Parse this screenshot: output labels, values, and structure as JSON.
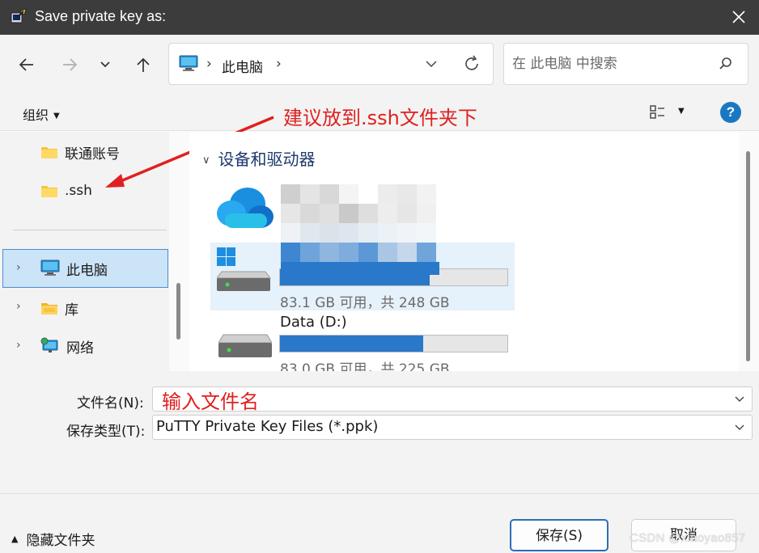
{
  "window": {
    "title": "Save private key as:"
  },
  "nav": {
    "breadcrumb": "此电脑",
    "search_placeholder": "在 此电脑 中搜索"
  },
  "toolbar": {
    "organize_label": "组织"
  },
  "annotations": {
    "folder_hint": "建议放到.ssh文件夹下",
    "filename_hint": "输入文件名"
  },
  "left_pane": {
    "items": [
      {
        "label": "联通账号"
      },
      {
        "label": ".ssh"
      },
      {
        "label": "此电脑"
      },
      {
        "label": "库"
      },
      {
        "label": "网络"
      }
    ]
  },
  "right_pane": {
    "group_label": "设备和驱动器",
    "drives": [
      {
        "name": "",
        "info": "",
        "icon": "onedrive-cloud-icon"
      },
      {
        "name": "",
        "info": "83.1 GB 可用，共 248 GB",
        "used_fraction": 0.66,
        "icon": "windows-drive-icon"
      },
      {
        "name": "Data (D:)",
        "info": "83.0 GB 可用，共 225 GB",
        "used_fraction": 0.63,
        "icon": "drive-icon"
      }
    ]
  },
  "form": {
    "filename_label": "文件名(N):",
    "filename_value": "",
    "filetype_label": "保存类型(T):",
    "filetype_value": "PuTTY Private Key Files (*.ppk)"
  },
  "footer": {
    "hide_folders_label": "隐藏文件夹",
    "save_label": "保存(S)",
    "cancel_label": "取消"
  },
  "watermark": "CSDN @xiaoyao857",
  "colors": {
    "accent": "#2a78c9",
    "annotation": "#e02020",
    "selection": "#cce4f7"
  }
}
